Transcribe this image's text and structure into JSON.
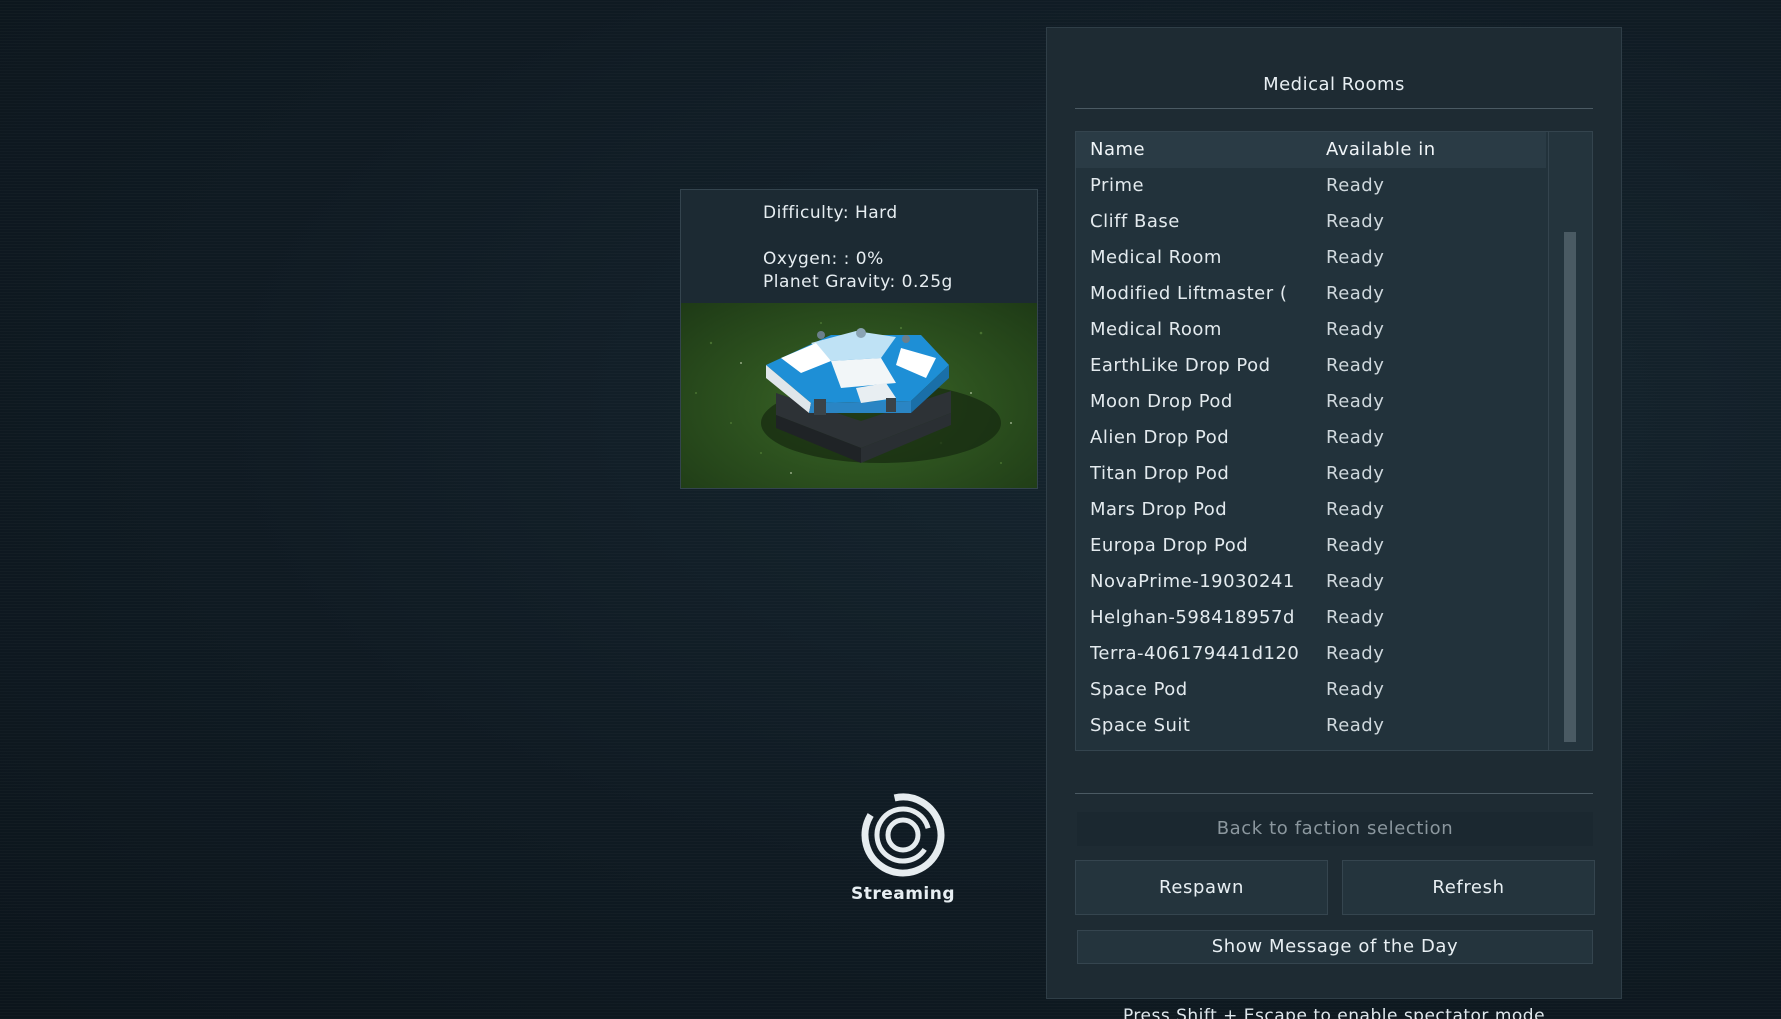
{
  "preview": {
    "difficulty": "Difficulty: Hard",
    "oxygen": "Oxygen: : 0%",
    "gravity": "Planet Gravity: 0.25g",
    "image_icon": "medical-room-block-icon"
  },
  "streaming": {
    "label": "Streaming",
    "icon": "streaming-spinner-icon"
  },
  "panel": {
    "title": "Medical Rooms",
    "columns": {
      "name": "Name",
      "available": "Available in"
    },
    "rows": [
      {
        "name": "Prime",
        "available": "Ready"
      },
      {
        "name": "Cliff Base",
        "available": "Ready"
      },
      {
        "name": "Medical Room",
        "available": "Ready"
      },
      {
        "name": "Modified Liftmaster (",
        "available": "Ready"
      },
      {
        "name": "Medical Room",
        "available": "Ready"
      },
      {
        "name": "EarthLike Drop Pod",
        "available": "Ready"
      },
      {
        "name": "Moon Drop Pod",
        "available": "Ready"
      },
      {
        "name": "Alien Drop Pod",
        "available": "Ready"
      },
      {
        "name": "Titan Drop Pod",
        "available": "Ready"
      },
      {
        "name": "Mars Drop Pod",
        "available": "Ready"
      },
      {
        "name": "Europa Drop Pod",
        "available": "Ready"
      },
      {
        "name": "NovaPrime-19030241",
        "available": "Ready"
      },
      {
        "name": "Helghan-598418957d",
        "available": "Ready"
      },
      {
        "name": "Terra-406179441d120",
        "available": "Ready"
      },
      {
        "name": "Space Pod",
        "available": "Ready"
      },
      {
        "name": "Space Suit",
        "available": "Ready"
      }
    ],
    "buttons": {
      "back": "Back to faction selection",
      "respawn": "Respawn",
      "refresh": "Refresh",
      "motd": "Show Message of the Day"
    }
  },
  "footer_hint": "Press Shift + Escape to enable spectator mode",
  "colors": {
    "background": "#0f1a22",
    "panel": "#1e2b33",
    "header_row": "#2a3b45",
    "accent_blue": "#1e90d8"
  }
}
